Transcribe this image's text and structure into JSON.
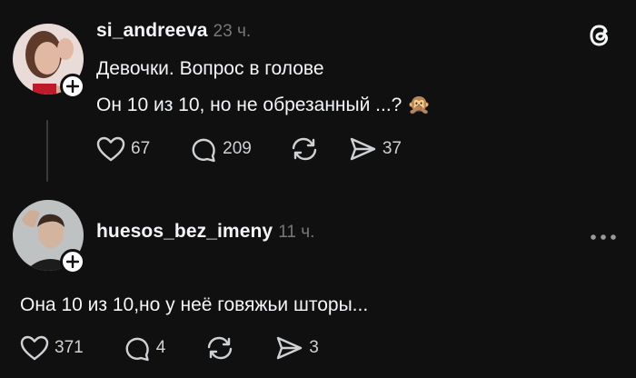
{
  "post": {
    "username": "si_andreeva",
    "time": "23 ч.",
    "line1": "Девочки. Вопрос в голове",
    "line2": "Он 10 из 10, но не обрезанный ...? 🙊",
    "likes": "67",
    "comments": "209",
    "shares": "37"
  },
  "reply": {
    "username": "huesos_bez_imeny",
    "time": "11 ч.",
    "text": "Она 10 из 10,но у неё говяжьи шторы...",
    "likes": "371",
    "comments": "4",
    "shares": "3"
  },
  "icons": {
    "app": "threads-logo-icon",
    "more": "more-dots-icon",
    "like": "heart-icon",
    "comment": "comment-icon",
    "repost": "repost-icon",
    "share": "send-icon"
  }
}
